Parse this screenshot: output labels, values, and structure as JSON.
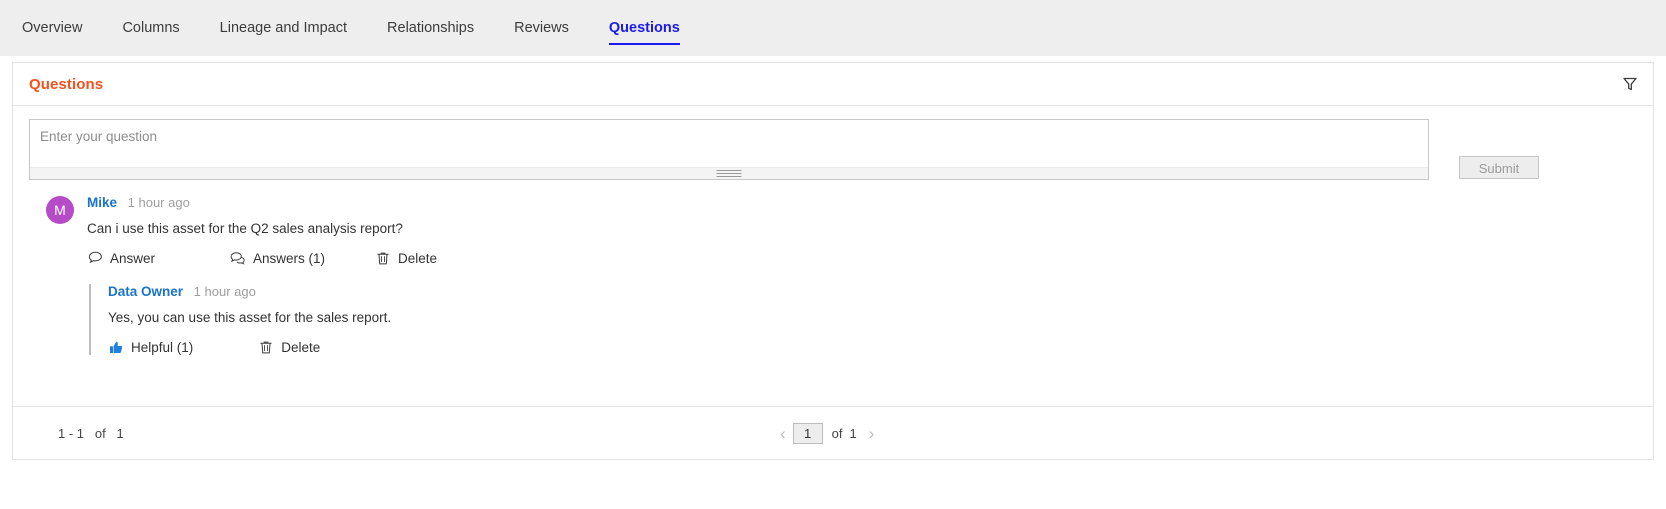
{
  "tabs": [
    {
      "label": "Overview",
      "active": false
    },
    {
      "label": "Columns",
      "active": false
    },
    {
      "label": "Lineage and Impact",
      "active": false
    },
    {
      "label": "Relationships",
      "active": false
    },
    {
      "label": "Reviews",
      "active": false
    },
    {
      "label": "Questions",
      "active": true
    }
  ],
  "card": {
    "title": "Questions",
    "filter_icon": "filter-funnel-icon"
  },
  "composer": {
    "placeholder": "Enter your question",
    "value": "",
    "submit_label": "Submit",
    "resize_handle": "resize-grip-icon"
  },
  "question": {
    "avatar_initial": "M",
    "avatar_color": "#b64bc8",
    "author": "Mike",
    "timestamp": "1 hour ago",
    "text": "Can i use this asset for the Q2 sales analysis report?",
    "actions": [
      {
        "label": "Answer",
        "icon": "comment-bubble-icon"
      },
      {
        "label": "Answers (1)",
        "icon": "comments-multiple-icon"
      },
      {
        "label": "Delete",
        "icon": "trash-icon"
      }
    ]
  },
  "answer": {
    "author": "Data Owner",
    "timestamp": "1 hour ago",
    "text": "Yes, you can use this asset for the sales report.",
    "actions": [
      {
        "label": "Helpful (1)",
        "icon": "thumbs-up-icon"
      },
      {
        "label": "Delete",
        "icon": "trash-icon"
      }
    ]
  },
  "pagination": {
    "range_text": "1 - 1   of   1",
    "prev_icon": "chevron-left-icon",
    "next_icon": "chevron-right-icon",
    "current_page": "1",
    "of_label": "of",
    "total_pages": "1"
  },
  "colors": {
    "accent_orange": "#f4511e",
    "link_blue": "#1a73c8",
    "tab_active_blue": "#1a1af0",
    "avatar_purple": "#b64bc8"
  }
}
